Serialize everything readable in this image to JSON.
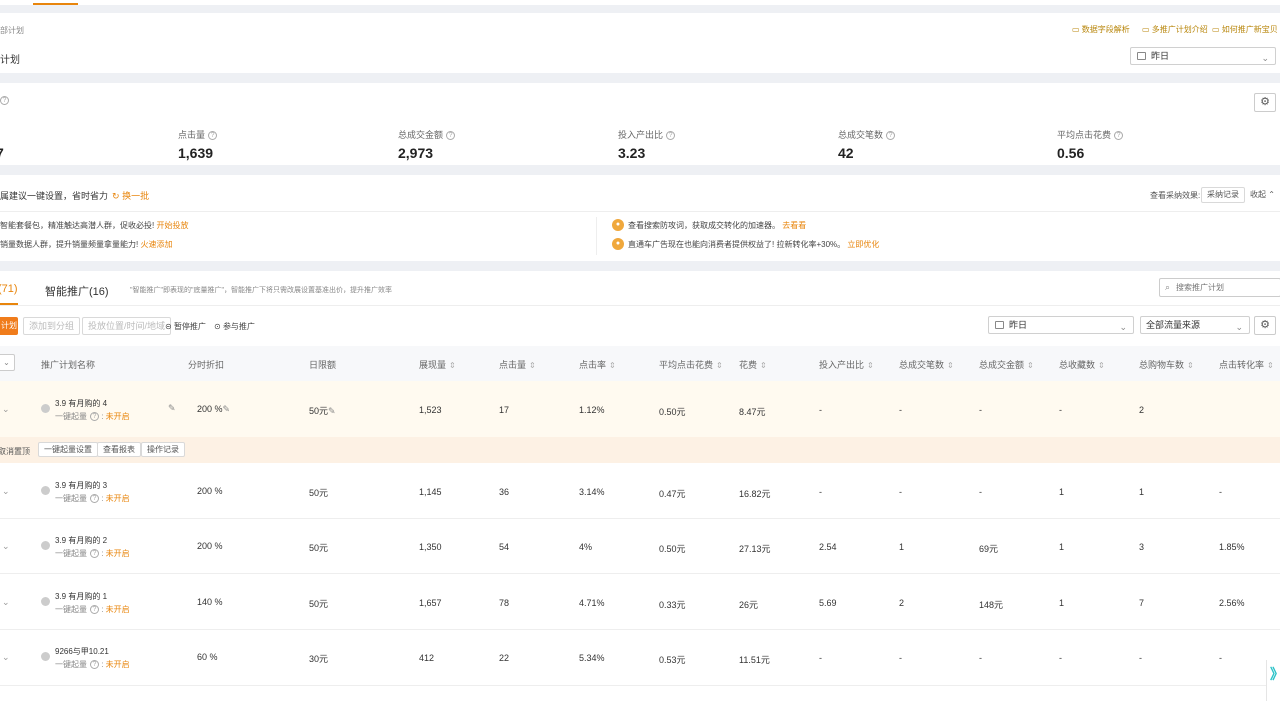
{
  "header": {
    "breadcrumb": "部计划",
    "title": "计划",
    "links": [
      "数据字段解析",
      "多推广计划介绍",
      "如何推广新宝贝"
    ],
    "date_select": "昨日"
  },
  "metrics": [
    {
      "label": "点击量",
      "value": "1,639"
    },
    {
      "label": "总成交金额",
      "value": "2,973"
    },
    {
      "label": "投入产出比",
      "value": "3.23"
    },
    {
      "label": "总成交笔数",
      "value": "42"
    },
    {
      "label": "平均点击花费",
      "value": "0.56"
    }
  ],
  "metrics_partial": "7",
  "suggestions": {
    "title": "属建议一键设置，省时省力",
    "refresh": "换一批",
    "view_effect": "查看采纳效果:",
    "record_btn": "采纳记录",
    "collapse": "收起",
    "items": [
      {
        "text": "智能套餐包，精准触达高潜人群，促收必投!",
        "action": "开始投放"
      },
      {
        "text": "销量数据人群，提升销量频量拿量能力!",
        "action": "火速添加"
      },
      {
        "text": "查看搜索防攻词，获取成交转化的加速器。",
        "action": "去看看"
      },
      {
        "text": "直通车广告现在也能向消费者提供权益了! 拉新转化率+30%。",
        "action": "立即优化"
      }
    ]
  },
  "tabs": {
    "tab1": "(71)",
    "tab2": "智能推广(16)",
    "note": "\"智能推广\"即表现的\"底量推广\"，智能推广下将只需改展设置基准出价，提升推广效率"
  },
  "search": {
    "placeholder": "搜索推广计划"
  },
  "toolbar": {
    "new_btn": "计划",
    "add_group": "添加到分组",
    "placement": "投放位置/时间/地域",
    "pause": "暂停推广",
    "join": "参与推广",
    "date": "昨日",
    "source": "全部流量来源"
  },
  "columns": [
    "推广计划名称",
    "分时折扣",
    "日限额",
    "展现量",
    "点击量",
    "点击率",
    "平均点击花费",
    "花费",
    "投入产出比",
    "总成交笔数",
    "总成交金额",
    "总收藏数",
    "总购物车数",
    "点击转化率"
  ],
  "row_sub_label": "一键起量",
  "row_status": "未开启",
  "row_actions": [
    "取消置顶",
    "一键起量设置",
    "查看报表",
    "操作记录"
  ],
  "rows": [
    {
      "name": "3.9 有月购的 4",
      "discount": "200 %",
      "limit": "50元",
      "impr": "1,523",
      "clicks": "17",
      "ctr": "1.12%",
      "cpc": "0.50元",
      "cost": "8.47元",
      "roi": "-",
      "orders": "-",
      "gmv": "-",
      "fav": "-",
      "cart": "2",
      "cvr": ""
    },
    {
      "name": "3.9 有月购的 3",
      "discount": "200 %",
      "limit": "50元",
      "impr": "1,145",
      "clicks": "36",
      "ctr": "3.14%",
      "cpc": "0.47元",
      "cost": "16.82元",
      "roi": "-",
      "orders": "-",
      "gmv": "-",
      "fav": "1",
      "cart": "1",
      "cvr": "-"
    },
    {
      "name": "3.9 有月购的 2",
      "discount": "200 %",
      "limit": "50元",
      "impr": "1,350",
      "clicks": "54",
      "ctr": "4%",
      "cpc": "0.50元",
      "cost": "27.13元",
      "roi": "2.54",
      "orders": "1",
      "gmv": "69元",
      "fav": "1",
      "cart": "3",
      "cvr": "1.85%"
    },
    {
      "name": "3.9 有月购的 1",
      "discount": "140 %",
      "limit": "50元",
      "impr": "1,657",
      "clicks": "78",
      "ctr": "4.71%",
      "cpc": "0.33元",
      "cost": "26元",
      "roi": "5.69",
      "orders": "2",
      "gmv": "148元",
      "fav": "1",
      "cart": "7",
      "cvr": "2.56%"
    },
    {
      "name": "9266与甲10.21",
      "discount": "60 %",
      "limit": "30元",
      "impr": "412",
      "clicks": "22",
      "ctr": "5.34%",
      "cpc": "0.53元",
      "cost": "11.51元",
      "roi": "-",
      "orders": "-",
      "gmv": "-",
      "fav": "-",
      "cart": "-",
      "cvr": "-"
    }
  ],
  "colors": {
    "accent": "#e8850c",
    "orange_btn": "#f07c1b"
  }
}
